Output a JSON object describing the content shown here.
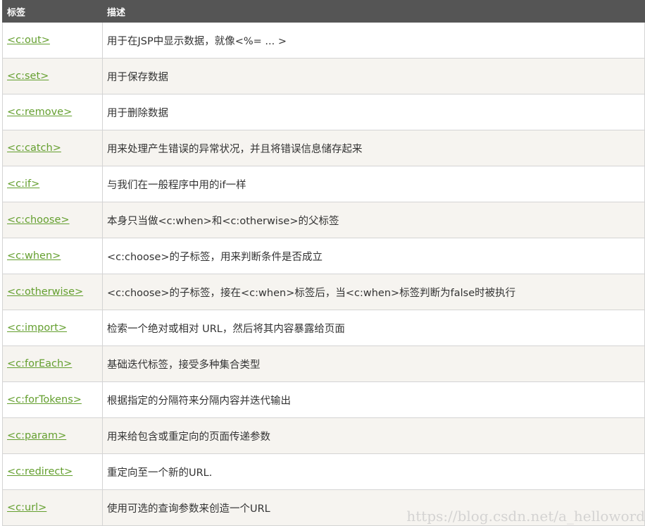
{
  "table": {
    "headers": [
      "标签",
      "描述"
    ],
    "rows": [
      {
        "tag": "<c:out>",
        "desc": "用于在JSP中显示数据，就像<%= ... >"
      },
      {
        "tag": "<c:set>",
        "desc": "用于保存数据"
      },
      {
        "tag": "<c:remove>",
        "desc": "用于删除数据"
      },
      {
        "tag": "<c:catch>",
        "desc": "用来处理产生错误的异常状况，并且将错误信息储存起来"
      },
      {
        "tag": "<c:if>",
        "desc": "与我们在一般程序中用的if一样"
      },
      {
        "tag": "<c:choose>",
        "desc": "本身只当做<c:when>和<c:otherwise>的父标签"
      },
      {
        "tag": "<c:when>",
        "desc": "<c:choose>的子标签，用来判断条件是否成立"
      },
      {
        "tag": "<c:otherwise>",
        "desc": "<c:choose>的子标签，接在<c:when>标签后，当<c:when>标签判断为false时被执行"
      },
      {
        "tag": "<c:import>",
        "desc": "检索一个绝对或相对 URL，然后将其内容暴露给页面"
      },
      {
        "tag": "<c:forEach>",
        "desc": "基础迭代标签，接受多种集合类型"
      },
      {
        "tag": "<c:forTokens>",
        "desc": "根据指定的分隔符来分隔内容并迭代输出"
      },
      {
        "tag": "<c:param>",
        "desc": "用来给包含或重定向的页面传递参数"
      },
      {
        "tag": "<c:redirect>",
        "desc": "重定向至一个新的URL."
      },
      {
        "tag": "<c:url>",
        "desc": "使用可选的查询参数来创造一个URL"
      }
    ]
  },
  "watermark": "https://blog.csdn.net/a_helloword"
}
